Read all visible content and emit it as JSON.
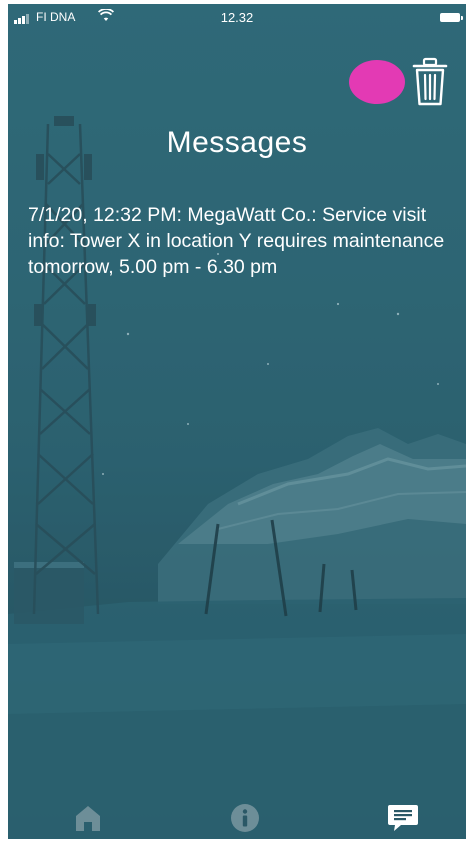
{
  "status_bar": {
    "carrier": "FI DNA",
    "time": "12.32"
  },
  "header": {
    "title": "Messages"
  },
  "messages": [
    {
      "text": "7/1/20, 12:32 PM: MegaWatt Co.: Service visit info: Tower X in location Y requires maintenance tomorrow, 5.00 pm - 6.30 pm"
    }
  ],
  "icons": {
    "delete": "trash-icon",
    "home": "home-icon",
    "info": "info-icon",
    "messages": "message-icon"
  },
  "colors": {
    "accent_dot": "#e33ab4",
    "background": "#2d6472",
    "active_tab": "#ffffff",
    "inactive_tab": "#6d8e98"
  },
  "tabs": {
    "active": "messages"
  }
}
